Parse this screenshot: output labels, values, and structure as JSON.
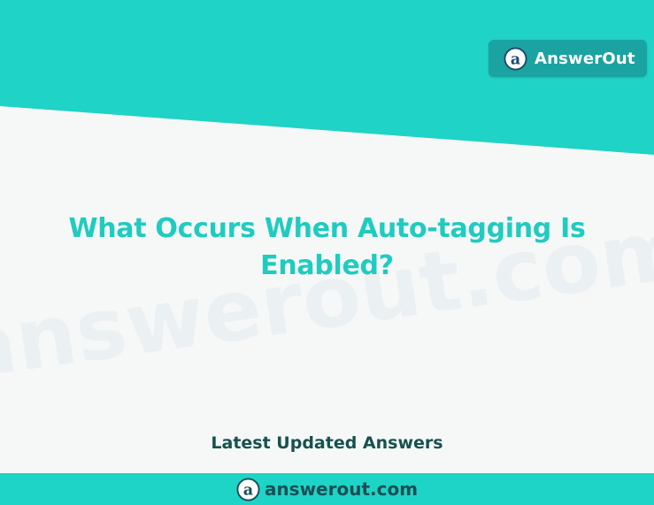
{
  "brand": {
    "name": "AnswerOut",
    "logo_icon": "answerout-a-logo-icon",
    "color": "#1aa3a1"
  },
  "hero": {
    "question": "What Occurs When Auto-tagging Is Enabled?",
    "accent_color": "#1fd3c6"
  },
  "watermark": {
    "text": "answerout.com"
  },
  "section": {
    "latest_label": "Latest Updated Answers"
  },
  "footer": {
    "domain": "answerout.com",
    "logo_icon": "answerout-a-logo-icon",
    "bar_color": "#1ed4c6"
  }
}
